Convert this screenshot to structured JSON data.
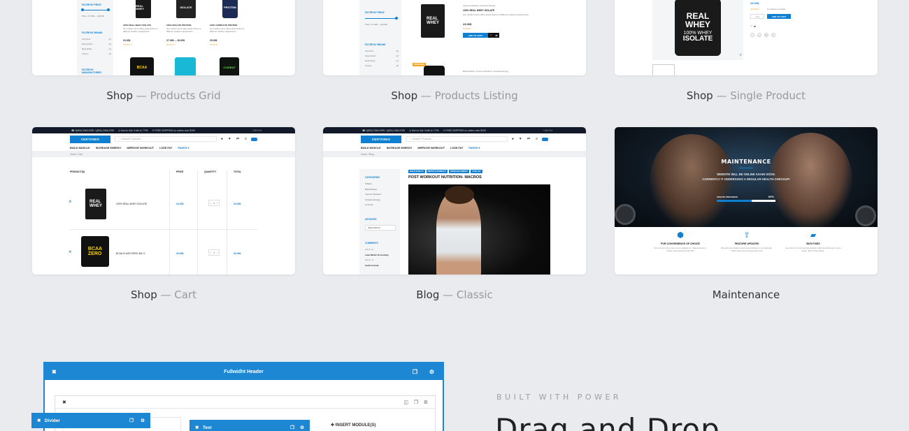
{
  "cards": [
    {
      "title": "Shop",
      "subtitle": "Products Grid"
    },
    {
      "title": "Shop",
      "subtitle": "Products Listing"
    },
    {
      "title": "Shop",
      "subtitle": "Single Product"
    },
    {
      "title": "Shop",
      "subtitle": "Cart"
    },
    {
      "title": "Blog",
      "subtitle": "Classic"
    },
    {
      "title": "Maintenance",
      "subtitle": ""
    }
  ],
  "sep": "—",
  "grid": {
    "filter_price": "FILTER BY PRICE",
    "price_range": "Price: 17.00$ — 90.00$",
    "filter_brand": "FILTER BY BRAND",
    "brands": [
      {
        "name": "Cell Tech",
        "count": "(1)"
      },
      {
        "name": "MuscleTech",
        "count": "(2)"
      },
      {
        "name": "Real Whey",
        "count": "(1)"
      },
      {
        "name": "Xtreme",
        "count": "(3)"
      }
    ],
    "filter_manufacturer": "FILTER BY MANUFACTURER",
    "products": [
      {
        "name": "100% REAL WHEY ISOLATE",
        "price": "23.00$",
        "bag": "REAL WHEY"
      },
      {
        "name": "100% ISOLATE PROTEIN",
        "price": "27.00$ — 30.00$",
        "bag": "ISOLATE"
      },
      {
        "name": "100% COMPLETE PROTEIN",
        "price": "25.00$",
        "bag": "PROTEIN"
      }
    ],
    "blurb": "Our nutrition store offers great choice of different nutrition supplements."
  },
  "listing": {
    "filter_price": "FILTER BY PRICE",
    "price_range": "Price: 17.00$ — 90.00$",
    "filter_brand": "FILTER BY BRAND",
    "brands": [
      {
        "name": "Cell Tech",
        "count": "(3)"
      },
      {
        "name": "MuscleTech",
        "count": "(2)"
      },
      {
        "name": "Real Whey",
        "count": "(1)"
      },
      {
        "name": "Xtreme",
        "count": "(3)"
      }
    ],
    "cats": "Improve Workout, Increase Energy",
    "name": "100% REAL WHEY ISOLATE",
    "desc": "Our nutrition store offers great choice of different nutrition supplements.",
    "price": "23.00$",
    "add": "ADD TO CART",
    "badge": "FEATURED",
    "cats2": "Build Muscle, Improve Workout, Increase Energy"
  },
  "single": {
    "price": "23.00$",
    "reviews": "(1 customer review)",
    "add": "ADD TO CART",
    "bag_l1": "REAL",
    "bag_l2": "WHEY",
    "bag_l3": "100% WHEY",
    "bag_l4": "ISOLATE",
    "social": [
      "f",
      "y",
      "G+",
      "p"
    ]
  },
  "site": {
    "topbar": [
      "☎ 1(800) 2345-6789, 1(800) 2345-6789",
      "◷ Mon to Sat: 9 AM to 7 PM",
      "✈ FREE SHIPPING on orders over $100"
    ],
    "topbar_right": "USD $ ▾",
    "logo": "CERTIONIX",
    "search": "Search Products...",
    "nav": [
      "BUILD MUSCLE",
      "INCREASE ENERGY",
      "IMPROVE WORKOUT",
      "LOSE FAT"
    ],
    "pages": "PAGES ▾",
    "crumb_cart": "Home  /  Cart",
    "crumb_blog": "Home  /  Blog"
  },
  "cart": {
    "cols": [
      "PRODUCT(S)",
      "PRICE",
      "QUANTITY",
      "TOTAL"
    ],
    "rows": [
      {
        "name": "100% REAL WHEY ISOLATE",
        "price": "23.00$",
        "qty": "1",
        "total": "23.00$"
      },
      {
        "name": "BCAA FLASH ZERO 360 G",
        "price": "30.00$",
        "qty": "1",
        "total": "30.00$"
      }
    ]
  },
  "blog": {
    "tags": [
      "BUILD MUSCLE",
      "IMPROVE WORKOUT",
      "INCREASE ENERGY",
      "LOSE FAT"
    ],
    "title": "POST WORKOUT NUTRITION- MACROS",
    "categories_h": "CATEGORIES",
    "categories": [
      "Athletic",
      "Build Muscle",
      "Improve Workout",
      "Increase Energy",
      "Lose Fat"
    ],
    "archives_h": "ARCHIVES",
    "select": "Select Month",
    "comments_h": "COMMENTS",
    "comments": [
      "admin on",
      "Lean Model 10 servings",
      "admin on",
      "Audio Format"
    ]
  },
  "maint": {
    "title": "MAINTENANCE",
    "line1": "WEBSITE WILL BE ONLINE AGAIN SOON.",
    "line2": "CURRENTLY IT UNDERGOES A REGULAR HEALTH CHECKUP!",
    "progress_label": "UPDATE PROGRESS",
    "progress": "60%",
    "progress_value": 0.6,
    "features": [
      {
        "title": "FOR CONVENIENCE OF CHOICE",
        "text": "From time to time we put our website on maintenance to check if everything works OK!",
        "icon": "cube-icon"
      },
      {
        "title": "FEATURE UPDATES",
        "text": "We add new features and new functions to our website. That's what we're doing right now!",
        "icon": "upload-icon"
      },
      {
        "title": "BUG FIXES",
        "text": "Any kind of a commercial website might stumble upon some bugs. We're fixing these.",
        "icon": "folder-icon"
      }
    ]
  },
  "builder": {
    "header": "Fullwidht Header",
    "divider": "Divider",
    "text": "Text",
    "insert": "INSERT MODULE(S)"
  },
  "promo": {
    "eyebrow": "BUILT WITH POWER",
    "heading": "Drag and Drop"
  },
  "colors": {
    "accent": "#0e7fd1",
    "bg": "#e9ebee",
    "dark": "#121a2a"
  }
}
